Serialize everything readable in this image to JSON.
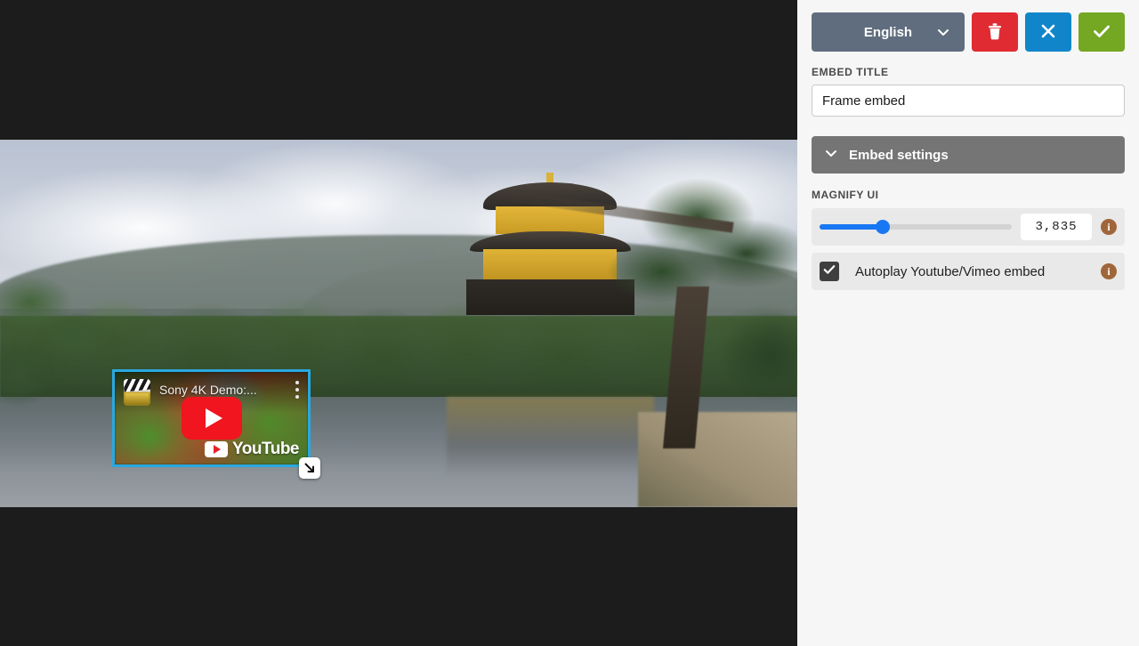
{
  "toolbar": {
    "language_label": "English",
    "language_chevron_icon": "chevron-down-icon",
    "delete_icon": "trash-icon",
    "cancel_icon": "close-x-icon",
    "confirm_icon": "checkmark-icon",
    "delete_color": "#e02b32",
    "cancel_color": "#1185ca",
    "confirm_color": "#74a722",
    "language_bg_color": "#5f6d7e"
  },
  "embed_title": {
    "label": "EMBED TITLE",
    "value": "Frame embed",
    "placeholder": "Frame embed"
  },
  "embed_settings": {
    "header_label": "Embed settings",
    "header_chevron_icon": "chevron-down-icon",
    "header_bg_color": "#757575",
    "magnify": {
      "label": "MAGNIFY UI",
      "value": "3,835",
      "slider_percent": 33,
      "slider_fill_color": "#1877f2",
      "info_icon": "info-icon"
    },
    "autoplay": {
      "label": "Autoplay Youtube/Vimeo embed",
      "checked": true,
      "check_icon": "checkmark-icon",
      "info_icon": "info-icon"
    }
  },
  "canvas": {
    "background_color": "#1c1c1c",
    "media_alt": "Kinkaku-ji golden pavilion beside a pond in Kyoto",
    "embed": {
      "selection_color": "#29a8e0",
      "channel_avatar_icon": "clapperboard-icon",
      "video_title": "Sony 4K Demo:...",
      "kebab_icon": "more-vertical-icon",
      "play_icon": "play-button-icon",
      "wordmark": "YouTube",
      "wordmark_badge_icon": "youtube-play-badge-icon"
    },
    "resize_handle_icon": "resize-diagonal-icon"
  }
}
